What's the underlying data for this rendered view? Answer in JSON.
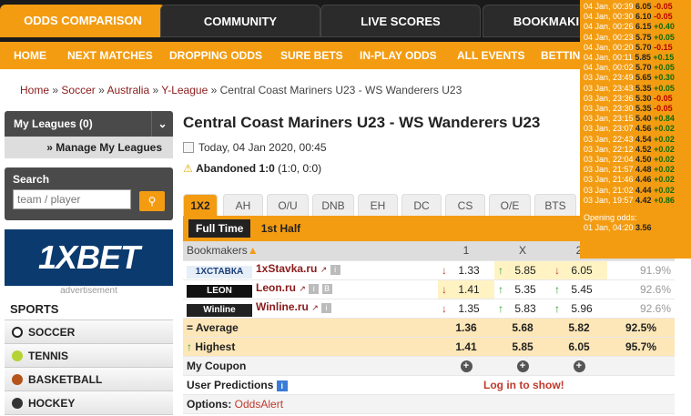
{
  "top_tabs": [
    "ODDS COMPARISON",
    "COMMUNITY",
    "LIVE SCORES",
    "BOOKMAKI"
  ],
  "nav": [
    "HOME",
    "NEXT MATCHES",
    "DROPPING ODDS",
    "SURE BETS",
    "IN-PLAY ODDS",
    "ALL EVENTS",
    "BETTIN"
  ],
  "breadcrumb": {
    "items": [
      "Home",
      "Soccer",
      "Australia",
      "Y-League"
    ],
    "current": "Central Coast Mariners U23 - WS Wanderers U23",
    "sep": "»"
  },
  "sidebar": {
    "my_leagues": "My Leagues (0)",
    "manage": "Manage My Leagues",
    "search_label": "Search",
    "search_placeholder": "team / player",
    "ad_label": "advertisement",
    "ad_brand": "1XBET",
    "sports_header": "SPORTS",
    "sports": [
      "SOCCER",
      "TENNIS",
      "BASKETBALL",
      "HOCKEY"
    ]
  },
  "match": {
    "title": "Central Coast Mariners U23 - WS Wanderers U23",
    "date": "Today, 04 Jan 2020, 00:45",
    "status_bold": "Abandoned 1:0",
    "status_rest": " (1:0, 0:0)"
  },
  "tabs": [
    "1X2",
    "AH",
    "O/U",
    "DNB",
    "EH",
    "DC",
    "CS",
    "O/E",
    "BTS"
  ],
  "subtabs": [
    "Full Time",
    "1st Half"
  ],
  "table": {
    "headers": [
      "Bookmakers",
      "1",
      "X",
      "2"
    ],
    "rows": [
      {
        "logo": "1XСТАВКА",
        "name": "1xStavka.ru",
        "o1": "1.33",
        "ox": "5.85",
        "o2": "6.05",
        "pay": "91.9%"
      },
      {
        "logo": "LEON",
        "name": "Leon.ru",
        "o1": "1.41",
        "ox": "5.35",
        "o2": "5.45",
        "pay": "92.6%"
      },
      {
        "logo": "Winline",
        "name": "Winline.ru",
        "o1": "1.35",
        "ox": "5.83",
        "o2": "5.96",
        "pay": "92.6%"
      }
    ],
    "average": {
      "label": "Average",
      "o1": "1.36",
      "ox": "5.68",
      "o2": "5.82",
      "pay": "92.5%"
    },
    "highest": {
      "label": "Highest",
      "o1": "1.41",
      "ox": "5.85",
      "o2": "6.05",
      "pay": "95.7%"
    },
    "coupon": "My Coupon",
    "predictions": "User Predictions",
    "login": "Log in to show!",
    "options_label": "Options:",
    "options_link": "OddsAlert"
  },
  "tooltip": {
    "rows": [
      [
        "04 Jan, 00:39",
        "6.05",
        "-0.05",
        "r"
      ],
      [
        "04 Jan, 00:30",
        "6.10",
        "-0.05",
        "r"
      ],
      [
        "04 Jan, 00:26",
        "6.15",
        "+0.40",
        "g"
      ],
      [
        "04 Jan, 00:23",
        "5.75",
        "+0.05",
        "g"
      ],
      [
        "04 Jan, 00:20",
        "5.70",
        "-0.15",
        "r"
      ],
      [
        "04 Jan, 00:11",
        "5.85",
        "+0.15",
        "g"
      ],
      [
        "04 Jan, 00:02",
        "5.70",
        "+0.05",
        "g"
      ],
      [
        "03 Jan, 23:49",
        "5.65",
        "+0.30",
        "g"
      ],
      [
        "03 Jan, 23:43",
        "5.35",
        "+0.05",
        "g"
      ],
      [
        "03 Jan, 23:36",
        "5.30",
        "-0.05",
        "r"
      ],
      [
        "03 Jan, 23:30",
        "5.35",
        "-0.05",
        "r"
      ],
      [
        "03 Jan, 23:15",
        "5.40",
        "+0.84",
        "g"
      ],
      [
        "03 Jan, 23:07",
        "4.56",
        "+0.02",
        "g"
      ],
      [
        "03 Jan, 22:43",
        "4.54",
        "+0.02",
        "g"
      ],
      [
        "03 Jan, 22:12",
        "4.52",
        "+0.02",
        "g"
      ],
      [
        "03 Jan, 22:04",
        "4.50",
        "+0.02",
        "g"
      ],
      [
        "03 Jan, 21:57",
        "4.48",
        "+0.02",
        "g"
      ],
      [
        "03 Jan, 21:46",
        "4.46",
        "+0.02",
        "g"
      ],
      [
        "03 Jan, 21:02",
        "4.44",
        "+0.02",
        "g"
      ],
      [
        "03 Jan, 19:57",
        "4.42",
        "+0.86",
        "g"
      ]
    ],
    "opening_label": "Opening odds:",
    "opening": "01 Jan, 04:20",
    "opening_val": "3.56"
  }
}
